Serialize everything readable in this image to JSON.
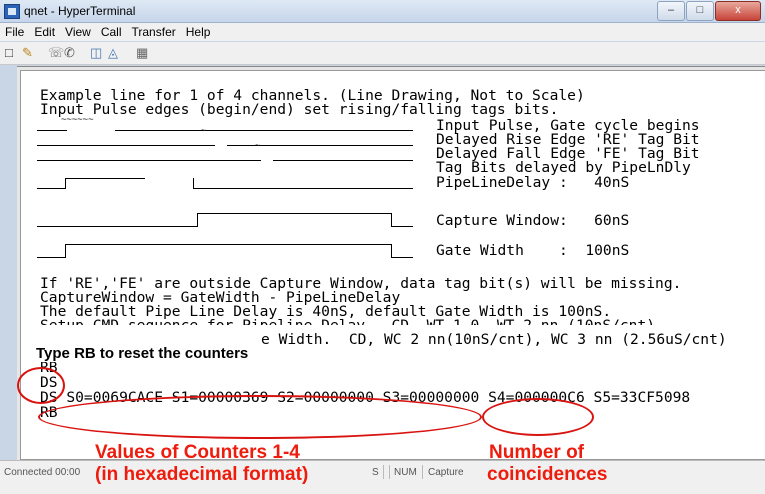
{
  "window": {
    "title": "qnet - HyperTerminal",
    "minimize": "–",
    "maximize": "□",
    "close": "x"
  },
  "menu": [
    "File",
    "Edit",
    "View",
    "Call",
    "Transfer",
    "Help"
  ],
  "toolbar_icons": [
    "new-icon",
    "open-icon",
    "disconnect-icon",
    "dial-icon",
    "send-icon",
    "receive-icon",
    "properties-icon"
  ],
  "terminal": {
    "lines": [
      "Example line for 1 of 4 channels. (Line Drawing, Not to Scale)",
      "Input Pulse edges (begin/end) set rising/falling tags bits.",
      "Input Pulse, Gate cycle begins",
      "Delayed Rise Edge 'RE' Tag Bit",
      "Delayed Fall Edge 'FE' Tag Bit",
      "Tag Bits delayed by PipeLnDly",
      "PipeLineDelay :   40nS",
      "Capture Window:   60nS",
      "Gate Width    :  100nS",
      "If 'RE','FE' are outside Capture Window, data tag bit(s) will be missing.",
      "CaptureWindow = GateWidth - PipeLineDelay",
      "The default Pipe Line Delay is 40nS, default Gate Width is 100nS.",
      "Setup CMD sequence for Pipeline Delay.  CD, WT 1 0, WT 2 nn (10nS/cnt)",
      "e Width.  CD, WC 2 nn(10nS/cnt), WC 3 nn (2.56uS/cnt)",
      "RB",
      "DS",
      "DS S0=0069CACE S1=00000369 S2=00000000 S3=00000000 S4=000000C6 S5=33CF5098",
      "RB"
    ]
  },
  "annotations": {
    "reset_hint": "Type RB to reset the counters",
    "counters_label_1": "Values of Counters 1-4",
    "counters_label_2": "(in hexadecimal format)",
    "coincidences_label_1": "Number of",
    "coincidences_label_2": "coincidences"
  },
  "statusbar": {
    "connected": "Connected 00:00",
    "segment_s": "S",
    "num": "NUM",
    "capture": "Capture"
  },
  "colors": {
    "annotation_red": "#ee1c0c",
    "ellipse_red": "#d9130f"
  }
}
